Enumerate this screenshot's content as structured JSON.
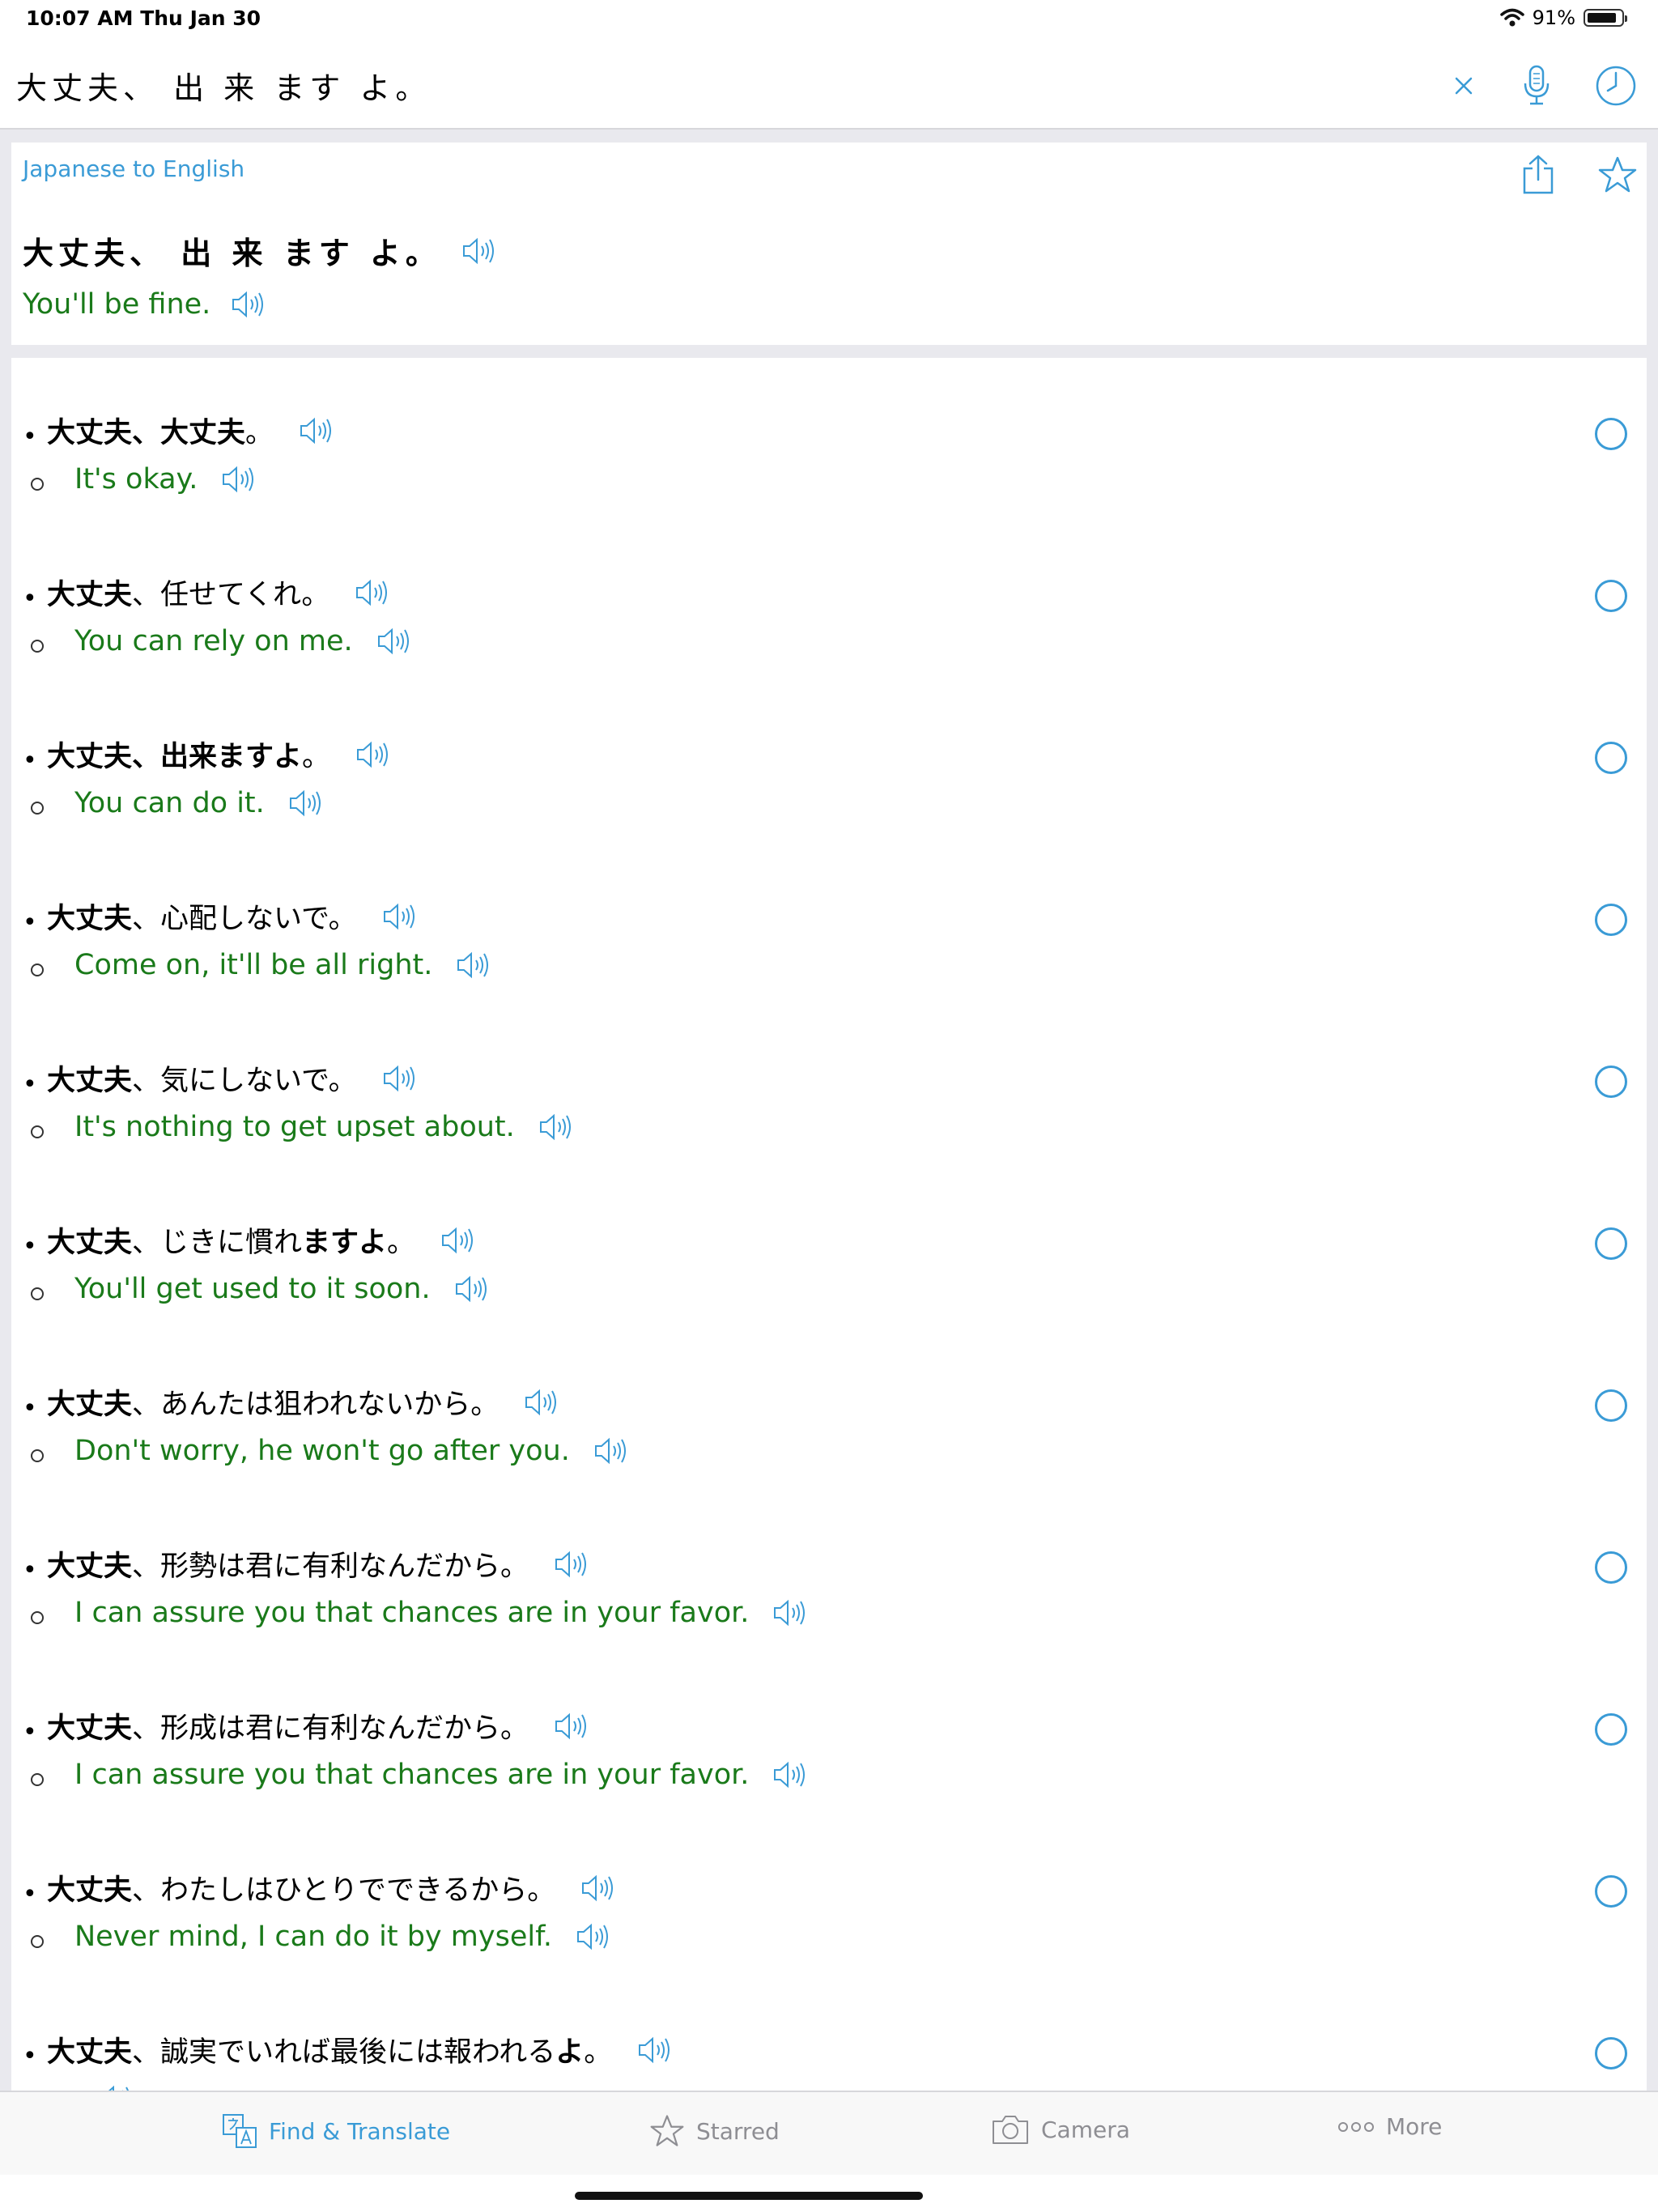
{
  "status_bar": {
    "time_date": "10:07 AM   Thu Jan 30",
    "battery": "91%",
    "battery_level": 0.91
  },
  "search": {
    "query": "大丈夫、 出 来 ます よ。"
  },
  "header": {
    "direction": "Japanese to English",
    "source": "大丈夫、 出 来 ます よ。",
    "translation": "You'll be fine."
  },
  "results": [
    {
      "jp_bold": "大丈夫、大丈夫",
      "jp_rest": "。",
      "jp_tail_bold": "",
      "jp_end": "",
      "en": "It's okay."
    },
    {
      "jp_bold": "大丈夫",
      "jp_rest": "、任せてくれ。",
      "jp_tail_bold": "",
      "jp_end": "",
      "en": "You can rely on me."
    },
    {
      "jp_bold": "大丈夫、出来ますよ",
      "jp_rest": "。",
      "jp_tail_bold": "",
      "jp_end": "",
      "en": "You can do it."
    },
    {
      "jp_bold": "大丈夫",
      "jp_rest": "、心配しないで。",
      "jp_tail_bold": "",
      "jp_end": "",
      "en": "Come on, it'll be all right."
    },
    {
      "jp_bold": "大丈夫",
      "jp_rest": "、気にしないで。",
      "jp_tail_bold": "",
      "jp_end": "",
      "en": "It's nothing to get upset about."
    },
    {
      "jp_bold": "大丈夫",
      "jp_rest": "、じきに慣れ",
      "jp_tail_bold": "ますよ",
      "jp_end": "。",
      "en": "You'll get used to it soon."
    },
    {
      "jp_bold": "大丈夫",
      "jp_rest": "、あんたは狙われないから。",
      "jp_tail_bold": "",
      "jp_end": "",
      "en": "Don't worry, he won't go after you."
    },
    {
      "jp_bold": "大丈夫",
      "jp_rest": "、形勢は君に有利なんだから。",
      "jp_tail_bold": "",
      "jp_end": "",
      "en": "I can assure you that chances are in your favor."
    },
    {
      "jp_bold": "大丈夫",
      "jp_rest": "、形成は君に有利なんだから。",
      "jp_tail_bold": "",
      "jp_end": "",
      "en": "I can assure you that chances are in your favor."
    },
    {
      "jp_bold": "大丈夫",
      "jp_rest": "、わたしはひとりでできるから。",
      "jp_tail_bold": "",
      "jp_end": "",
      "en": "Never mind, I can do it by myself."
    },
    {
      "jp_bold": "大丈夫",
      "jp_rest": "、誠実でいれば最後には報われる",
      "jp_tail_bold": "よ",
      "jp_end": "。",
      "en": ""
    }
  ],
  "tabs": [
    {
      "label": "Find & Translate",
      "icon": "translate-icon",
      "active": true
    },
    {
      "label": "Starred",
      "icon": "star-icon",
      "active": false
    },
    {
      "label": "Camera",
      "icon": "camera-icon",
      "active": false
    },
    {
      "label": "More",
      "icon": "more-icon",
      "active": false
    }
  ],
  "colors": {
    "accent": "#3a9bd6",
    "translation": "#1a7a1a",
    "inactive": "#8e8e93"
  }
}
